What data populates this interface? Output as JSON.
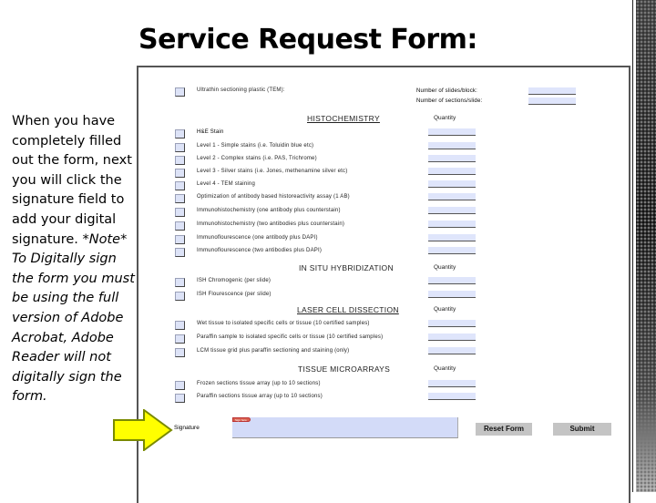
{
  "slide": {
    "title": "Service Request Form:",
    "instructions": "When you have completely filled out the form, next you will click the signature field to add your digital signature.",
    "note": "*Note* To Digitally sign the form you must be using the full version of Adobe Acrobat, Adobe Reader will not digitally sign the form."
  },
  "form": {
    "top": {
      "ultrathin_label": "Ultrathin sectioning plastic (TEM):",
      "slides_per_block_label": "Number of slides/block:",
      "sections_per_slide_label": "Number of sections/slide:"
    },
    "quantity_label": "Quantity",
    "sections": [
      {
        "title": "HISTOCHEMISTRY",
        "items": [
          "H&E Stain",
          "Level 1 - Simple stains (i.e. Toluidin blue etc)",
          "Level 2 - Complex stains (i.e. PAS, Trichrome)",
          "Level 3 - Silver stains (i.e. Jones, methenamine silver etc)",
          "Level 4 - TEM staining",
          "Optimization of antibody based historeactivity assay (1 AB)",
          "Immunohistochemistry (one antibody plus counterstain)",
          "Immunohistochemistry (two antibodies plus counterstain)",
          "Immunoflourescence (one antibody plus DAPI)",
          "Immunoflourescence (two antibodies plus DAPI)"
        ]
      },
      {
        "title": "IN SITU HYBRIDIZATION",
        "items": [
          "ISH Chromogenic (per slide)",
          "ISH Flourescence (per slide)"
        ]
      },
      {
        "title": "LASER CELL DISSECTION",
        "items": [
          "Wet tissue to isolated specific cells or tissue (10 certified samples)",
          "Paraffin sample to isolated specific cells or tissue (10 certified samples)",
          "LCM tissue grid plus paraffin sectioning and staining (only)"
        ]
      },
      {
        "title": "TISSUE MICROARRAYS",
        "items": [
          "Frozen sections tissue array (up to 10 sections)",
          "Paraffin sections tissue array (up to 10 sections)"
        ]
      }
    ],
    "signature_label": "Signature",
    "signature_flag": "Sign here",
    "reset_label": "Reset Form",
    "submit_label": "Submit"
  },
  "colors": {
    "field_fill": "#dfe5fb",
    "arrow_fill": "#ffff00",
    "arrow_stroke": "#7a8a00",
    "button_fill": "#c4c4c4"
  }
}
